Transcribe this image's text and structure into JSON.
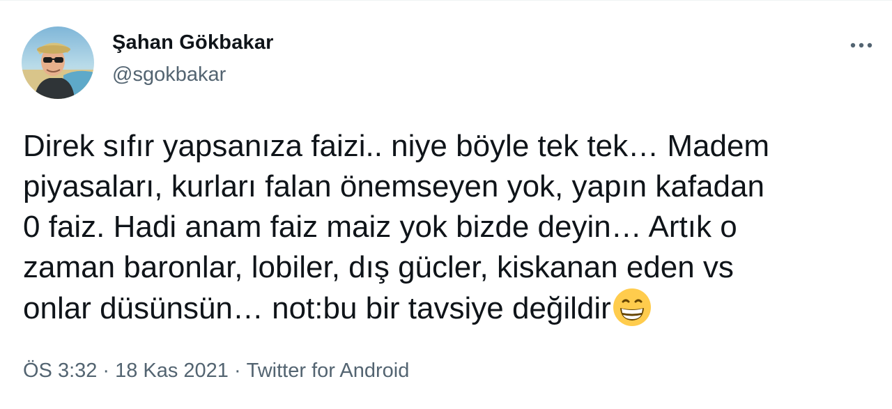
{
  "author": {
    "display_name": "Şahan Gökbakar",
    "handle": "@sgokbakar",
    "avatar_icon": "user-avatar-photo"
  },
  "tweet": {
    "text": "Direk sıfır yapsanıza faizi.. niye böyle tek tek… Madem\npiyasaları, kurları falan önemseyen yok, yapın kafadan\n0 faiz. Hadi anam faiz maiz yok bizde deyin… Artık o\nzaman baronlar, lobiler, dış gücler, kiskanan eden vs\nonlar düsünsün… not:bu bir tavsiye değildir",
    "emoji_icon": "grinning-face-icon"
  },
  "meta": {
    "time": "ÖS 3:32",
    "separator": "·",
    "date": "18 Kas 2021",
    "source": "Twitter for Android"
  },
  "menu": {
    "icon": "more-options-icon"
  },
  "colors": {
    "text_primary": "#0f1419",
    "text_secondary": "#536471",
    "emoji_yellow": "#ffcc4d"
  }
}
